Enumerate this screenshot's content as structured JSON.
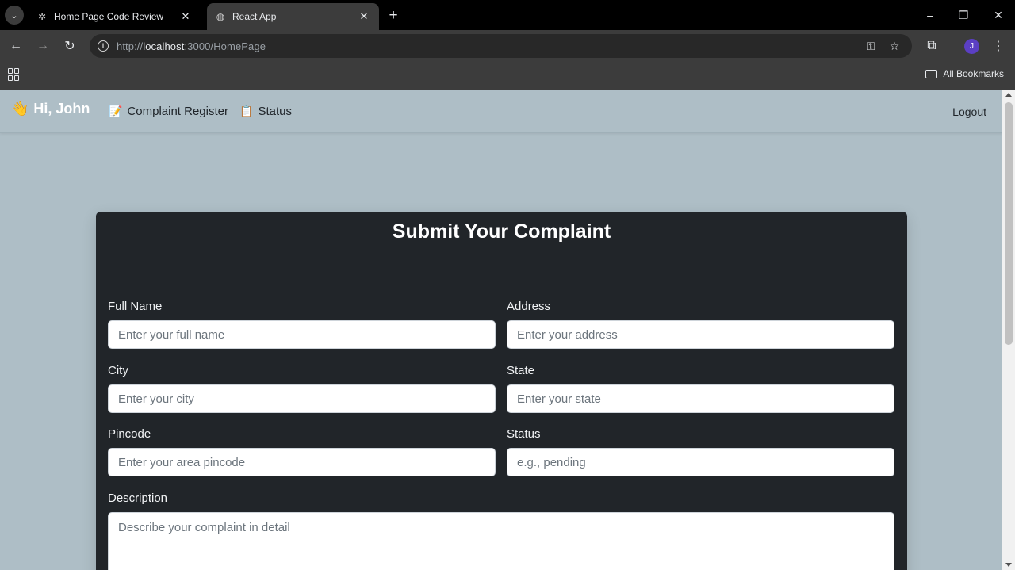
{
  "browser": {
    "tabs": [
      {
        "title": "Home Page Code Review",
        "favicon": "openai-icon",
        "active": false
      },
      {
        "title": "React App",
        "favicon": "globe-icon",
        "active": true
      }
    ],
    "url_scheme": "http://",
    "url_host": "localhost",
    "url_path": ":3000/HomePage",
    "bookmarks_label": "All Bookmarks",
    "profile_initial": "J"
  },
  "nav": {
    "greeting_emoji": "👋",
    "greeting": "Hi, John",
    "links": [
      {
        "emoji": "📝",
        "label": "Complaint Register"
      },
      {
        "emoji": "📋",
        "label": "Status"
      }
    ],
    "logout": "Logout"
  },
  "form": {
    "title": "Submit Your Complaint",
    "fields": {
      "full_name": {
        "label": "Full Name",
        "placeholder": "Enter your full name"
      },
      "address": {
        "label": "Address",
        "placeholder": "Enter your address"
      },
      "city": {
        "label": "City",
        "placeholder": "Enter your city"
      },
      "state": {
        "label": "State",
        "placeholder": "Enter your state"
      },
      "pincode": {
        "label": "Pincode",
        "placeholder": "Enter your area pincode"
      },
      "status": {
        "label": "Status",
        "placeholder": "e.g., pending"
      },
      "description": {
        "label": "Description",
        "placeholder": "Describe your complaint in detail"
      }
    }
  },
  "colors": {
    "page_bg": "#aebec6",
    "card_bg": "#212529",
    "chrome_bg": "#3c3c3c",
    "tabstrip_bg": "#000000"
  }
}
